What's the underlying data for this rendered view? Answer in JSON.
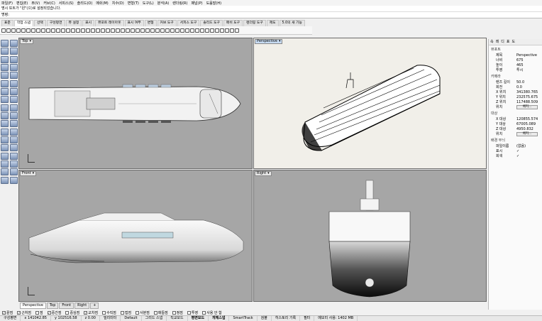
{
  "menu": [
    "파일(F)",
    "편집(E)",
    "뷰(V)",
    "커브(C)",
    "서피스(S)",
    "솔리드(O)",
    "메쉬(M)",
    "치수(D)",
    "변형(T)",
    "도구(L)",
    "분석(A)",
    "렌더링(R)",
    "패널(P)",
    "도움말(H)"
  ],
  "command_history": "명시 또트가 \"왼\"(으)로 설정되었습니다.",
  "command_prompt": "명령:",
  "toolbar_tabs": [
    "표준",
    "작업 스냅",
    "선택",
    "구성평면",
    "뷰 설정",
    "표시",
    "뷰포트 레이아웃",
    "표시 여부",
    "변형",
    "커브 도구",
    "서피스 도구",
    "솔리드 도구",
    "메쉬 도구",
    "렌더링 도구",
    "제도",
    "5.0의 새 기능"
  ],
  "active_toolbar_tab": 1,
  "viewports": {
    "top": {
      "label": "Top"
    },
    "perspective": {
      "label": "Perspective"
    },
    "front": {
      "label": "Front"
    },
    "right": {
      "label": "Right"
    }
  },
  "viewport_tabs": [
    "Perspective",
    "Top",
    "Front",
    "Right",
    "+"
  ],
  "osnaps": [
    {
      "label": "끝점",
      "checked": true
    },
    {
      "label": "근처점",
      "checked": true
    },
    {
      "label": "점",
      "checked": false
    },
    {
      "label": "중간점",
      "checked": true
    },
    {
      "label": "중심점",
      "checked": false
    },
    {
      "label": "교차점",
      "checked": true
    },
    {
      "label": "수직점",
      "checked": false
    },
    {
      "label": "접점",
      "checked": false
    },
    {
      "label": "사분점",
      "checked": false
    },
    {
      "label": "매듭점",
      "checked": false
    },
    {
      "label": "정점",
      "checked": false
    },
    {
      "label": "투영",
      "checked": false
    },
    {
      "label": "사용 안 함",
      "checked": false
    }
  ],
  "status": {
    "cplane": "구성평면",
    "x": "x 141042.85",
    "y": "y 102516.58",
    "z": "z 0.00",
    "unit": "밀리미터",
    "layer": "Default",
    "grid_snap": "그리드 스냅",
    "ortho": "직교모드",
    "planar": "평면모드",
    "osnap": "개체스냅",
    "smarttrack": "SmartTrack",
    "gumball": "검볼",
    "history": "히스토리 기록",
    "filter": "필터",
    "memory": "메모리 사용: 1402 MB"
  },
  "panel": {
    "tabs": [
      "속",
      "레",
      "디",
      "표",
      "도"
    ],
    "sections": {
      "viewport": "뷰포트",
      "camera": "카메라",
      "target": "대상",
      "wallpaper": "배경 무늬"
    },
    "viewport_rows": [
      {
        "k": "제목",
        "v": "Perspective"
      },
      {
        "k": "너비",
        "v": "675"
      },
      {
        "k": "높이",
        "v": "465"
      },
      {
        "k": "투영",
        "v": "투시"
      }
    ],
    "camera_rows": [
      {
        "k": "렌즈 길이",
        "v": "50.0"
      },
      {
        "k": "회전",
        "v": "0.0"
      },
      {
        "k": "X 위치",
        "v": "341380.765"
      },
      {
        "k": "Y 위치",
        "v": "232575.675"
      },
      {
        "k": "Z 위치",
        "v": "117488.509"
      },
      {
        "k": "위치",
        "v": "배치..."
      }
    ],
    "target_rows": [
      {
        "k": "X 대상",
        "v": "120855.574"
      },
      {
        "k": "Y 대상",
        "v": "67005.089"
      },
      {
        "k": "Z 대상",
        "v": "4950.832"
      },
      {
        "k": "위치",
        "v": "배치..."
      }
    ],
    "wallpaper_rows": [
      {
        "k": "파일이름",
        "v": "(없음)"
      },
      {
        "k": "표시",
        "v": "✓"
      },
      {
        "k": "회색",
        "v": "✓"
      }
    ]
  }
}
